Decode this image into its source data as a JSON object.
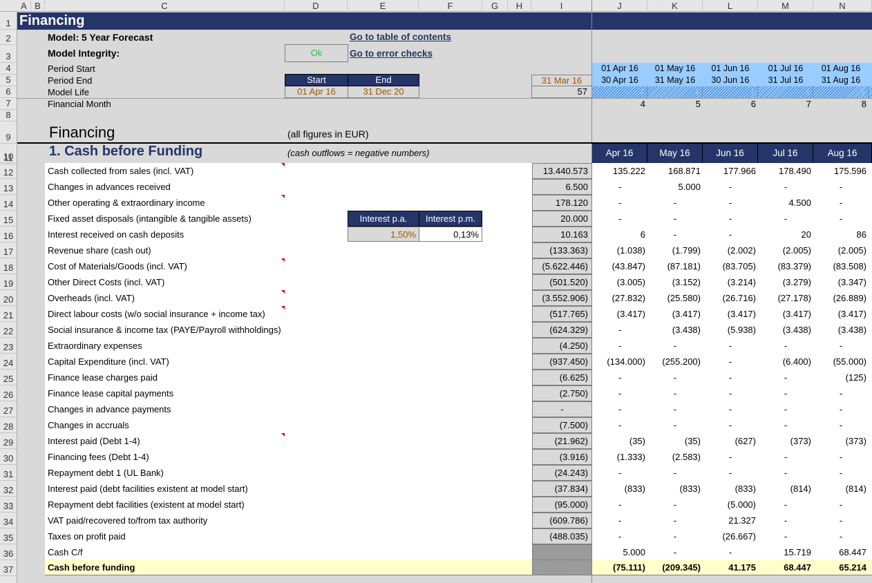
{
  "columns": [
    "A",
    "B",
    "C",
    "D",
    "E",
    "F",
    "G",
    "H",
    "I",
    "J",
    "K",
    "L",
    "M",
    "N"
  ],
  "rows": [
    "1",
    "2",
    "3",
    "4",
    "5",
    "6",
    "7",
    "8",
    "9",
    "10",
    "11",
    "12",
    "13",
    "14",
    "15",
    "16",
    "17",
    "18",
    "19",
    "20",
    "21",
    "22",
    "23",
    "24",
    "25",
    "26",
    "27",
    "28",
    "29",
    "30",
    "31",
    "32",
    "33",
    "34",
    "35",
    "36",
    "37"
  ],
  "sheet_title": "Financing",
  "header": {
    "model": "Model: 5 Year Forecast",
    "integrity_label": "Model Integrity:",
    "integrity_status": "Ok",
    "link_toc": "Go to table of contents",
    "link_errors": "Go to error checks",
    "period_start_label": "Period Start",
    "period_end_label": "Period End",
    "model_life_label": "Model Life",
    "financial_month_label": "Financial Month",
    "start_hdr": "Start",
    "end_hdr": "End",
    "start_val": "01 Apr 16",
    "end_val": "31 Dec 20",
    "prior_end": "31 Mar 16",
    "model_life_val": "57"
  },
  "timeline": {
    "period_start": [
      "01 Apr 16",
      "01 May 16",
      "01 Jun 16",
      "01 Jul 16",
      "01 Aug 16"
    ],
    "period_end": [
      "30 Apr 16",
      "31 May 16",
      "30 Jun 16",
      "31 Jul 16",
      "31 Aug 16"
    ],
    "flags": [
      "1",
      "1",
      "1",
      "1",
      "1"
    ],
    "financial_month": [
      "4",
      "5",
      "6",
      "7",
      "8"
    ]
  },
  "section": {
    "title": "Financing",
    "units": "(all figures in EUR)",
    "subtitle": "1. Cash before Funding",
    "note": "(cash outflows = negative numbers)",
    "months": [
      "Apr 16",
      "May 16",
      "Jun 16",
      "Jul 16",
      "Aug 16"
    ]
  },
  "interest": {
    "pa_label": "Interest p.a.",
    "pm_label": "Interest p.m.",
    "pa_value": "1,50%",
    "pm_value": "0,13%"
  },
  "lines": [
    {
      "label": "Cash collected from sales (incl. VAT)",
      "total": "13.440.573",
      "values": [
        "135.222",
        "168.871",
        "177.966",
        "178.490",
        "175.596"
      ]
    },
    {
      "label": "Changes in advances received",
      "total": "6.500",
      "values": [
        "-",
        "5.000",
        "-",
        "-",
        "-"
      ]
    },
    {
      "label": "Other operating & extraordinary income",
      "total": "178.120",
      "values": [
        "-",
        "-",
        "-",
        "4.500",
        "-"
      ]
    },
    {
      "label": "Fixed asset disposals (intangible & tangible assets)",
      "total": "20.000",
      "values": [
        "-",
        "-",
        "-",
        "-",
        "-"
      ]
    },
    {
      "label": "Interest received on cash deposits",
      "total": "10.163",
      "values": [
        "6",
        "-",
        "-",
        "20",
        "86"
      ]
    },
    {
      "label": "Revenue share (cash out)",
      "total": "(133.363)",
      "values": [
        "(1.038)",
        "(1.799)",
        "(2.002)",
        "(2.005)",
        "(2.005)"
      ]
    },
    {
      "label": "Cost of Materials/Goods (incl. VAT)",
      "total": "(5.622.446)",
      "values": [
        "(43.847)",
        "(87.181)",
        "(83.705)",
        "(83.379)",
        "(83.508)"
      ]
    },
    {
      "label": "Other Direct Costs (incl. VAT)",
      "total": "(501.520)",
      "values": [
        "(3.005)",
        "(3.152)",
        "(3.214)",
        "(3.279)",
        "(3.347)"
      ]
    },
    {
      "label": "Overheads (incl. VAT)",
      "total": "(3.552.906)",
      "values": [
        "(27.832)",
        "(25.580)",
        "(26.716)",
        "(27.178)",
        "(26.889)"
      ]
    },
    {
      "label": "Direct labour costs (w/o social insurance + income tax)",
      "total": "(517.765)",
      "values": [
        "(3.417)",
        "(3.417)",
        "(3.417)",
        "(3.417)",
        "(3.417)"
      ]
    },
    {
      "label": "Social insurance & income tax (PAYE/Payroll withholdings)",
      "total": "(624.329)",
      "values": [
        "-",
        "(3.438)",
        "(5.938)",
        "(3.438)",
        "(3.438)"
      ]
    },
    {
      "label": "Extraordinary expenses",
      "total": "(4.250)",
      "values": [
        "-",
        "-",
        "-",
        "-",
        "-"
      ]
    },
    {
      "label": "Capital Expenditure (incl. VAT)",
      "total": "(937.450)",
      "values": [
        "(134.000)",
        "(255.200)",
        "-",
        "(6.400)",
        "(55.000)"
      ]
    },
    {
      "label": "Finance lease charges paid",
      "total": "(6.625)",
      "values": [
        "-",
        "-",
        "-",
        "-",
        "(125)"
      ]
    },
    {
      "label": "Finance lease capital payments",
      "total": "(2.750)",
      "values": [
        "-",
        "-",
        "-",
        "-",
        "-"
      ]
    },
    {
      "label": "Changes in advance payments",
      "total": "-",
      "values": [
        "-",
        "-",
        "-",
        "-",
        "-"
      ]
    },
    {
      "label": "Changes in accruals",
      "total": "(7.500)",
      "values": [
        "-",
        "-",
        "-",
        "-",
        "-"
      ]
    },
    {
      "label": "Interest paid (Debt 1-4)",
      "total": "(21.962)",
      "values": [
        "(35)",
        "(35)",
        "(627)",
        "(373)",
        "(373)"
      ]
    },
    {
      "label": "Financing fees (Debt 1-4)",
      "total": "(3.916)",
      "values": [
        "(1.333)",
        "(2.583)",
        "-",
        "-",
        "-"
      ]
    },
    {
      "label": "Repayment debt 1 (UL Bank)",
      "total": "(24.243)",
      "values": [
        "-",
        "-",
        "-",
        "-",
        "-"
      ]
    },
    {
      "label": "Interest paid (debt facilities existent at model start)",
      "total": "(37.834)",
      "values": [
        "(833)",
        "(833)",
        "(833)",
        "(814)",
        "(814)"
      ]
    },
    {
      "label": "Repayment debt facilities (existent at model start)",
      "total": "(95.000)",
      "values": [
        "-",
        "-",
        "(5.000)",
        "-",
        "-"
      ]
    },
    {
      "label": "VAT paid/recovered to/from tax authority",
      "total": "(609.786)",
      "values": [
        "-",
        "-",
        "21.327",
        "-",
        "-"
      ]
    },
    {
      "label": "Taxes on profit paid",
      "total": "(488.035)",
      "values": [
        "-",
        "-",
        "(26.667)",
        "-",
        "-"
      ]
    },
    {
      "label": "Cash C/f",
      "total": "",
      "values": [
        "5.000",
        "-",
        "-",
        "15.719",
        "68.447"
      ]
    }
  ],
  "total_line": {
    "label": "Cash before funding",
    "values": [
      "(75.111)",
      "(209.345)",
      "41.175",
      "68.447",
      "65.214"
    ]
  },
  "comment_rows": [
    0,
    2,
    6,
    8,
    9,
    17
  ]
}
